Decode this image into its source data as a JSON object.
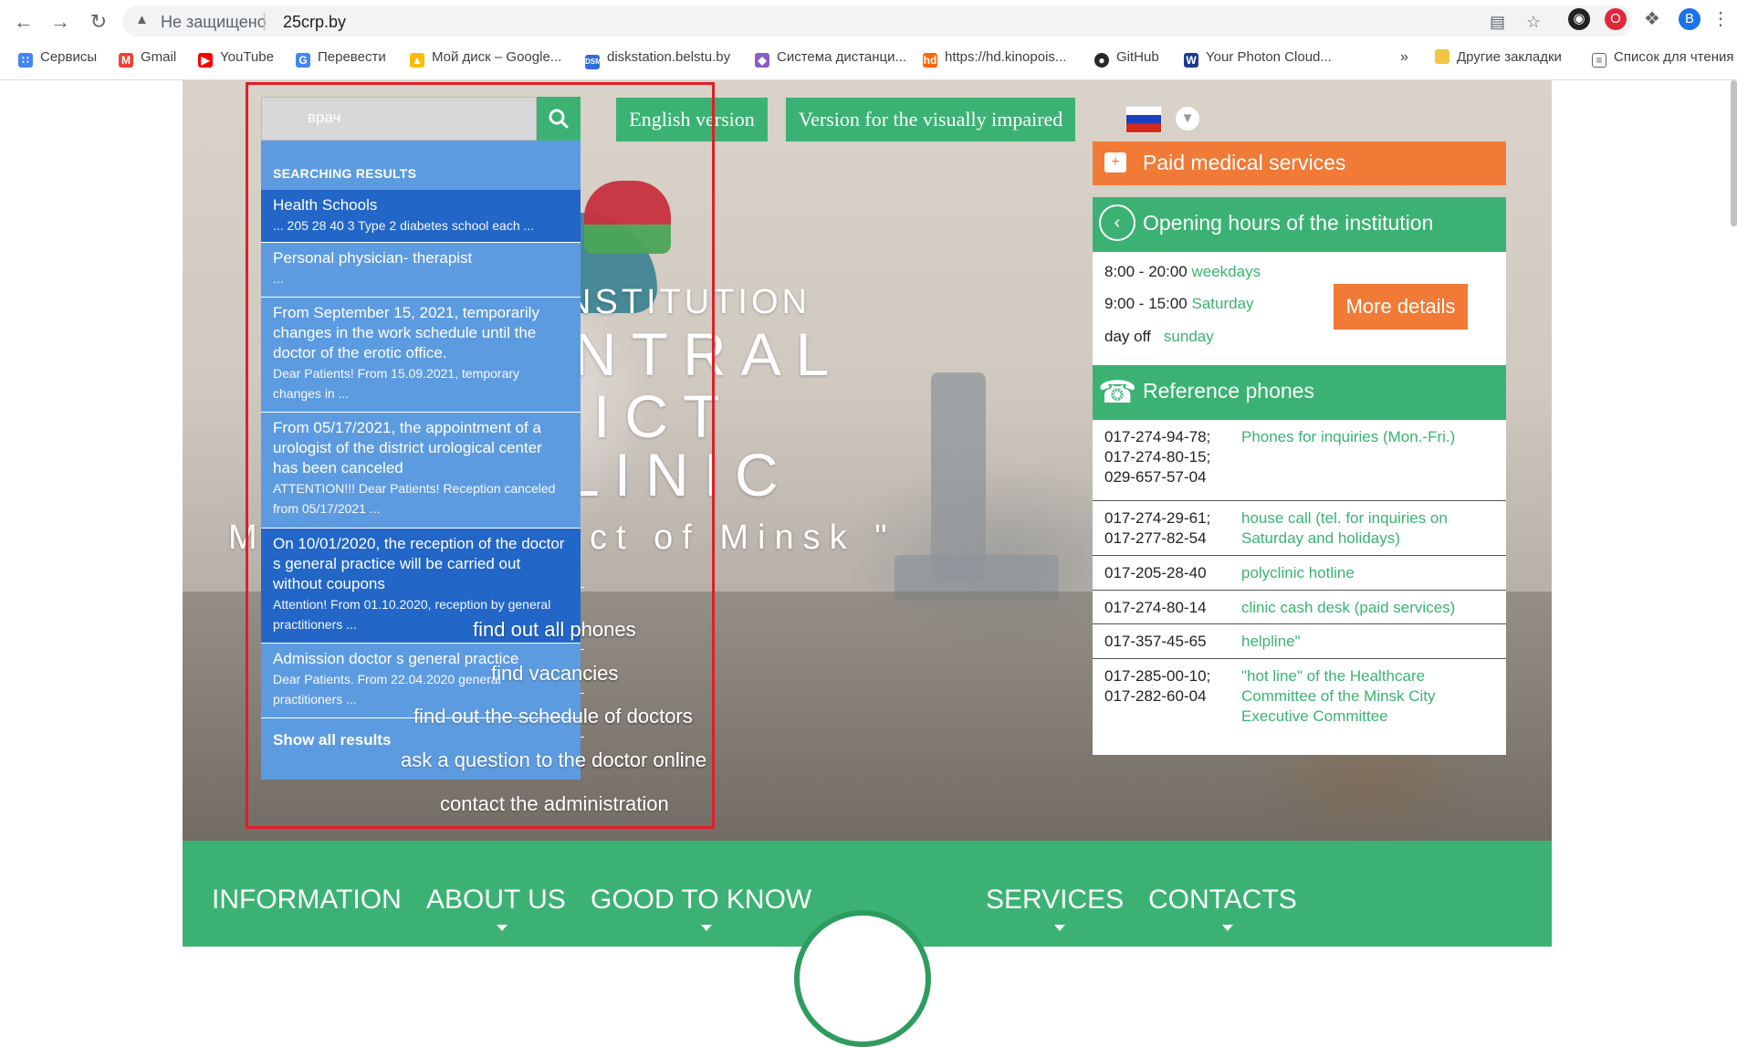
{
  "browser": {
    "security_label": "Не защищено",
    "url": "25crp.by",
    "profile_letter": "B",
    "bookmarks": [
      {
        "label": "Сервисы"
      },
      {
        "label": "Gmail"
      },
      {
        "label": "YouTube"
      },
      {
        "label": "Перевести"
      },
      {
        "label": "Мой диск – Google..."
      },
      {
        "label": "diskstation.belstu.by"
      },
      {
        "label": "Система дистанци..."
      },
      {
        "label": "https://hd.kinopois..."
      },
      {
        "label": "GitHub"
      },
      {
        "label": "Your Photon Cloud..."
      }
    ],
    "more_bookmarks": "»",
    "other_bookmarks": "Другие закладки",
    "reading_list": "Список для чтения"
  },
  "header": {
    "english_version": "English version",
    "visually_impaired": "Version for the visually impaired"
  },
  "hero": {
    "line1": "NSTITUTION",
    "line2": "NTRAL",
    "line3": "ICT",
    "line4": "LINIC",
    "line5_left": "M",
    "line5_right": "ct of Minsk \""
  },
  "search": {
    "value": "врач",
    "results_heading": "SEARCHING RESULTS",
    "results": [
      {
        "title": "Health Schools",
        "snippet": "... 205 28 40 3 Type 2 diabetes school each ..."
      },
      {
        "title": "Personal physician- therapist",
        "snippet": "..."
      },
      {
        "title": "From September 15, 2021, temporarily changes in the work schedule until the doctor of the erotic office.",
        "snippet": "Dear Patients! From 15.09.2021, temporary changes in ..."
      },
      {
        "title": "From 05/17/2021, the appointment of a urologist of the district urological center has been canceled",
        "snippet": "ATTENTION!!! Dear Patients! Reception canceled from 05/17/2021 ..."
      },
      {
        "title": "On 10/01/2020, the reception of the doctor s general practice will be carried out without coupons",
        "snippet": "Attention! From 01.10.2020, reception by general practitioners ..."
      },
      {
        "title": "Admission doctor s general practice",
        "snippet": "Dear Patients. From 22.04.2020 general practitioners ..."
      }
    ],
    "show_all": "Show all results"
  },
  "quick_links": [
    "find out all phones",
    "find vacancies",
    "find out the schedule of doctors",
    "ask a question to the doctor online",
    "contact the administration"
  ],
  "sidebar": {
    "paid_services": "Paid medical services",
    "opening_hours_title": "Opening hours of the institution",
    "hours": [
      {
        "time": "8:00 - 20:00",
        "day": "weekdays"
      },
      {
        "time": "9:00 - 15:00",
        "day": "Saturday"
      },
      {
        "time": "day off",
        "day": "sunday"
      }
    ],
    "more_details": "More details",
    "phones_title": "Reference phones",
    "phones": [
      {
        "numbers": "017-274-94-78; 017-274-80-15; 029-657-57-04",
        "desc": "Phones for inquiries (Mon.-Fri.)"
      },
      {
        "numbers": "017-274-29-61; 017-277-82-54",
        "desc": "house call (tel. for inquiries on Saturday and holidays)"
      },
      {
        "numbers": "017-205-28-40",
        "desc": "polyclinic hotline"
      },
      {
        "numbers": "017-274-80-14",
        "desc": "clinic cash desk (paid services)"
      },
      {
        "numbers": "017-357-45-65",
        "desc": "helpline\""
      },
      {
        "numbers": "017-285-00-10; 017-282-60-04",
        "desc": "\"hot line\" of the Healthcare Committee of the Minsk City Executive Committee"
      }
    ]
  },
  "bottom_nav": [
    {
      "label": "INFORMATION"
    },
    {
      "label": "ABOUT US"
    },
    {
      "label": "GOOD TO KNOW"
    },
    {
      "label": "SERVICES"
    },
    {
      "label": "CONTACTS"
    }
  ],
  "colors": {
    "brand_green": "#3bb273",
    "accent_orange": "#f07a36",
    "result_blue": "#5d9be0",
    "result_active": "#2266c8",
    "highlight_red": "#e21d2a"
  }
}
